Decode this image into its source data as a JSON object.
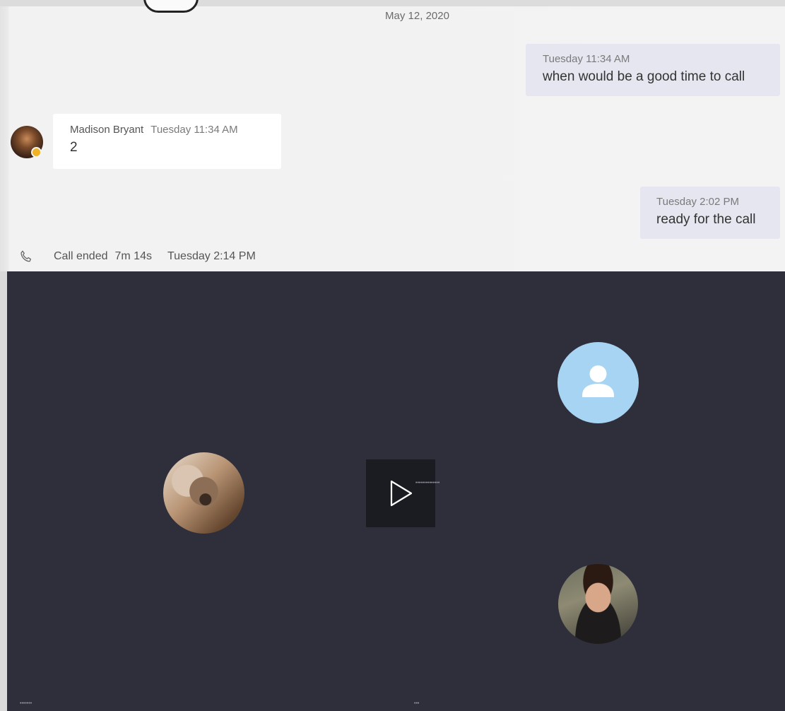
{
  "chat": {
    "date_divider": "May 12, 2020",
    "messages": [
      {
        "direction": "out",
        "timestamp": "Tuesday 11:34 AM",
        "text": "when would be a good time to call"
      },
      {
        "direction": "in",
        "sender": "Madison Bryant",
        "timestamp": "Tuesday 11:34 AM",
        "text": "2"
      },
      {
        "direction": "out",
        "timestamp": "Tuesday 2:02 PM",
        "text": "ready for the call"
      }
    ],
    "call_event": {
      "label": "Call ended",
      "duration": "7m 14s",
      "timestamp": "Tuesday 2:14 PM",
      "icon": "phone-icon"
    }
  },
  "video": {
    "play_icon": "play-icon",
    "placeholder_icon": "person-icon",
    "tile_caption": "••••••••••••••",
    "participant_labels": [
      "•••••••",
      "•••"
    ]
  },
  "colors": {
    "outgoing_bubble": "#e6e6f1",
    "incoming_bubble": "#ffffff",
    "stage_background": "#2f2f3c",
    "placeholder_avatar": "#a7d4f3",
    "presence": "#f0b323"
  }
}
